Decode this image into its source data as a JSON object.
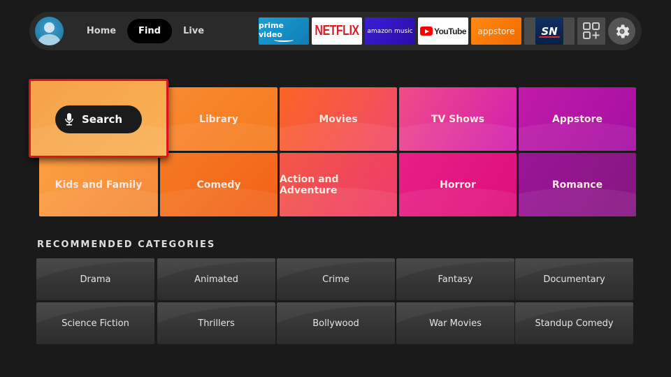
{
  "nav": {
    "tabs": [
      {
        "label": "Home",
        "selected": false
      },
      {
        "label": "Find",
        "selected": true
      },
      {
        "label": "Live",
        "selected": false
      }
    ],
    "apps": [
      {
        "name": "prime-video",
        "label": "prime video"
      },
      {
        "name": "netflix",
        "label": "NETFLIX"
      },
      {
        "name": "amazon-music",
        "label": "amazon music"
      },
      {
        "name": "youtube",
        "label": "YouTube"
      },
      {
        "name": "appstore",
        "label": "appstore"
      },
      {
        "name": "sportsnet",
        "label": "SN"
      }
    ],
    "icons": {
      "profile": "user-avatar-icon",
      "add_apps": "apps-grid-plus-icon",
      "settings": "gear-icon"
    }
  },
  "categories": {
    "search": {
      "label": "Search",
      "icon": "microphone-icon",
      "focused": true
    },
    "tiles": [
      {
        "label": "Library"
      },
      {
        "label": "Movies"
      },
      {
        "label": "TV Shows"
      },
      {
        "label": "Appstore"
      },
      {
        "label": "Kids and Family"
      },
      {
        "label": "Comedy"
      },
      {
        "label": "Action and Adventure"
      },
      {
        "label": "Horror"
      },
      {
        "label": "Romance"
      }
    ]
  },
  "recommended": {
    "title": "RECOMMENDED CATEGORIES",
    "items": [
      {
        "label": "Drama"
      },
      {
        "label": "Animated"
      },
      {
        "label": "Crime"
      },
      {
        "label": "Fantasy"
      },
      {
        "label": "Documentary"
      },
      {
        "label": "Science Fiction"
      },
      {
        "label": "Thrillers"
      },
      {
        "label": "Bollywood"
      },
      {
        "label": "War Movies"
      },
      {
        "label": "Standup Comedy"
      }
    ]
  },
  "colors": {
    "focus_border": "#d8161b",
    "background": "#1a1a1a",
    "navbar": "#2a2a2a"
  }
}
